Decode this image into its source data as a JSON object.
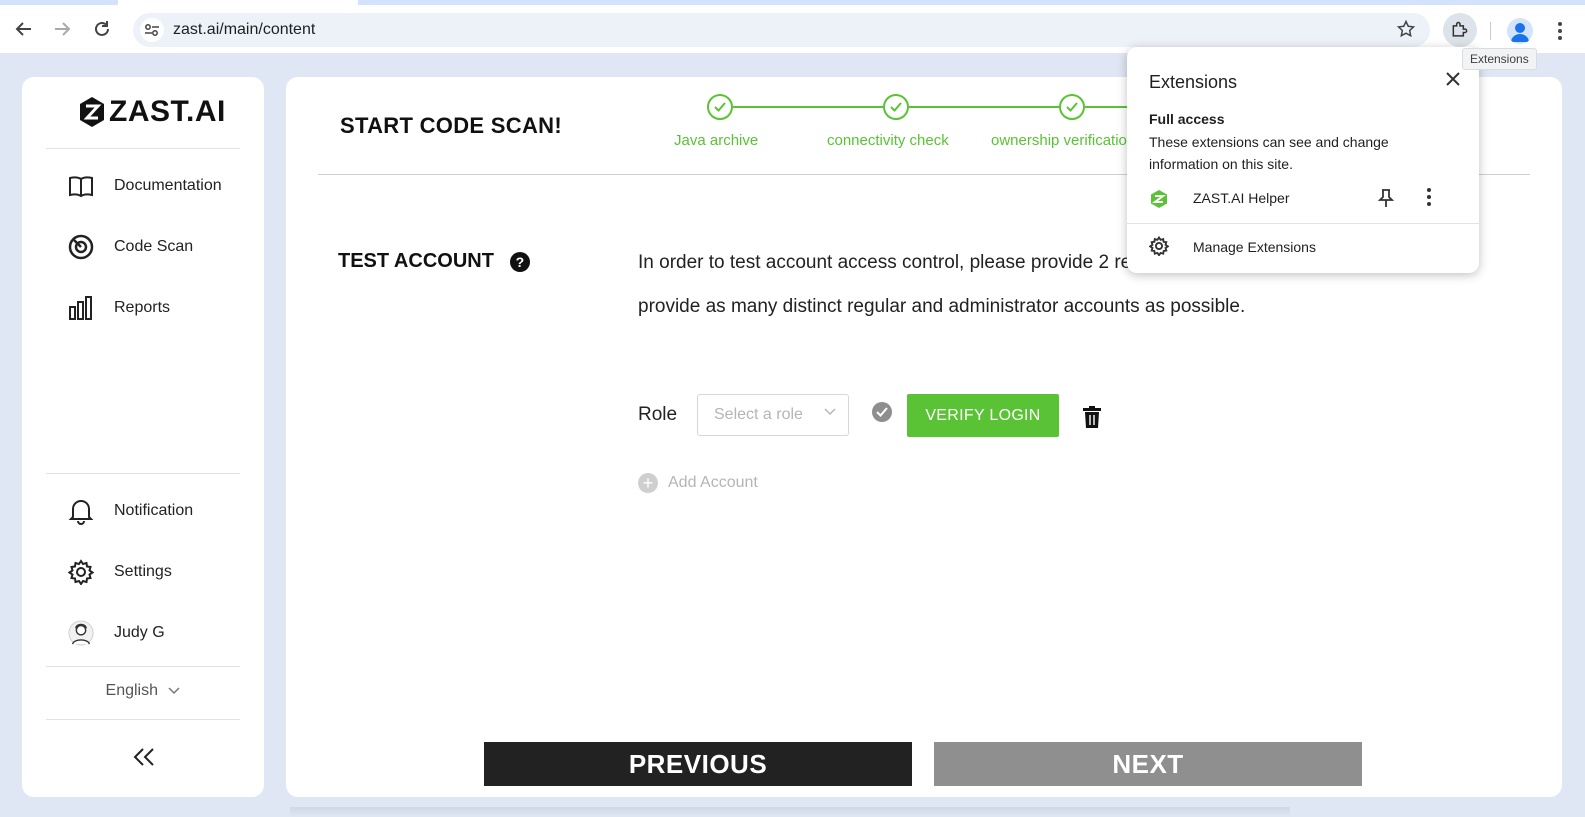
{
  "browser": {
    "url": "zast.ai/main/content",
    "tooltip": "Extensions"
  },
  "sidebar": {
    "logo": "ZAST.AI",
    "items": [
      {
        "label": "Documentation",
        "icon": "book-icon"
      },
      {
        "label": "Code Scan",
        "icon": "scan-icon"
      },
      {
        "label": "Reports",
        "icon": "bar-chart-icon"
      }
    ],
    "bottom_items": [
      {
        "label": "Notification",
        "icon": "bell-icon"
      },
      {
        "label": "Settings",
        "icon": "gear-icon"
      },
      {
        "label": "Judy G",
        "icon": "avatar"
      }
    ],
    "language": "English"
  },
  "main": {
    "title": "START CODE SCAN!",
    "steps": [
      {
        "label": "Java archive",
        "status": "done"
      },
      {
        "label": "connectivity check",
        "status": "done"
      },
      {
        "label": "ownership verificatio",
        "status": "done"
      }
    ],
    "section_title": "TEST ACCOUNT",
    "description": "In order to test account access control, please provide 2 reg account. If this is not possible, provide as many distinct regular and administrator accounts as possible.",
    "role_label": "Role",
    "role_placeholder": "Select a role",
    "verify_label": "VERIFY LOGIN",
    "add_account": "Add Account",
    "previous": "PREVIOUS",
    "next": "NEXT"
  },
  "extensions_popup": {
    "title": "Extensions",
    "subtitle": "Full access",
    "description": "These extensions can see and change information on this site.",
    "extension_name": "ZAST.AI Helper",
    "manage": "Manage Extensions"
  },
  "colors": {
    "accent": "#5ac335",
    "dark_button": "#222222",
    "disabled_button": "#8f8f8f",
    "page_bg": "#dfe7f4"
  }
}
